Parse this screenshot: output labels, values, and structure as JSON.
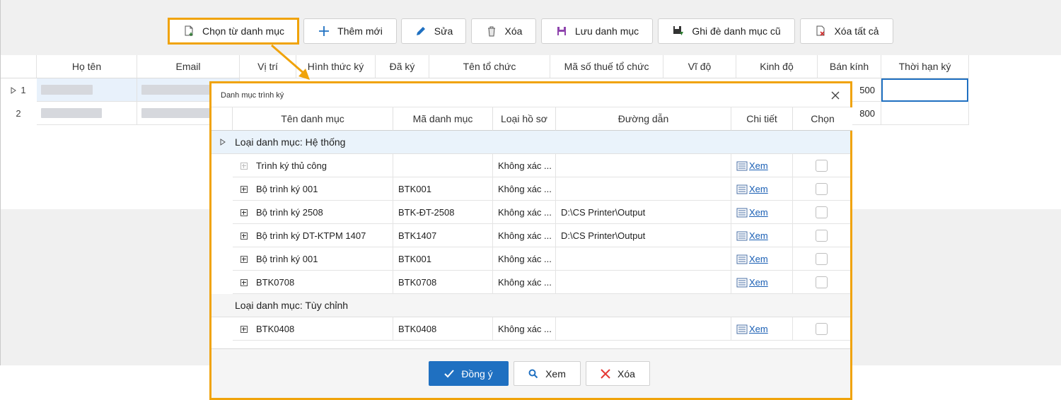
{
  "toolbar": {
    "choose_label": "Chọn từ danh mục",
    "add_label": "Thêm mới",
    "edit_label": "Sửa",
    "delete_label": "Xóa",
    "save_catalog_label": "Lưu danh mục",
    "overwrite_label": "Ghi đè danh mục cũ",
    "delete_all_label": "Xóa tất cả"
  },
  "grid": {
    "headers": [
      "Họ tên",
      "Email",
      "Vị trí",
      "Hình thức ký",
      "Đã ký",
      "Tên tổ chức",
      "Mã số thuế tổ chức",
      "Vĩ độ",
      "Kinh độ",
      "Bán kính",
      "Thời hạn ký"
    ],
    "rows": [
      {
        "index": "1",
        "radius": "500"
      },
      {
        "index": "2",
        "radius": "800"
      }
    ]
  },
  "dialog": {
    "title": "Danh mục trình ký",
    "headers": [
      "Tên danh mục",
      "Mã danh mục",
      "Loại hồ sơ",
      "Đường dẫn",
      "Chi tiết",
      "Chọn"
    ],
    "group1": "Loại danh mục: Hệ thống",
    "group2": "Loại danh mục: Tùy chỉnh",
    "rows": [
      {
        "name": "Trình ký thủ công",
        "code": "",
        "type": "Không xác ...",
        "path": "",
        "detail": "Xem"
      },
      {
        "name": "Bộ trình ký 001",
        "code": "BTK001",
        "type": "Không xác ...",
        "path": "",
        "detail": "Xem"
      },
      {
        "name": "Bộ trình ký 2508",
        "code": "BTK-ĐT-2508",
        "type": "Không xác ...",
        "path": "D:\\CS Printer\\Output",
        "detail": "Xem"
      },
      {
        "name": "Bộ trình ký DT-KTPM 1407",
        "code": "BTK1407",
        "type": "Không xác ...",
        "path": "D:\\CS Printer\\Output",
        "detail": "Xem"
      },
      {
        "name": "Bộ trình ký 001",
        "code": "BTK001",
        "type": "Không xác ...",
        "path": "",
        "detail": "Xem"
      },
      {
        "name": "BTK0708",
        "code": "BTK0708",
        "type": "Không xác ...",
        "path": "",
        "detail": "Xem"
      },
      {
        "name": "BTK0408",
        "code": "BTK0408",
        "type": "Không xác ...",
        "path": "",
        "detail": "Xem"
      }
    ],
    "ok_label": "Đồng ý",
    "view_label": "Xem",
    "delete_label": "Xóa"
  },
  "colors": {
    "highlight": "#f0a30a",
    "primary": "#1f70c1",
    "link": "#1a5fb4",
    "group_bg": "#eaf3fb",
    "selected_row": "#e8f1fb"
  }
}
